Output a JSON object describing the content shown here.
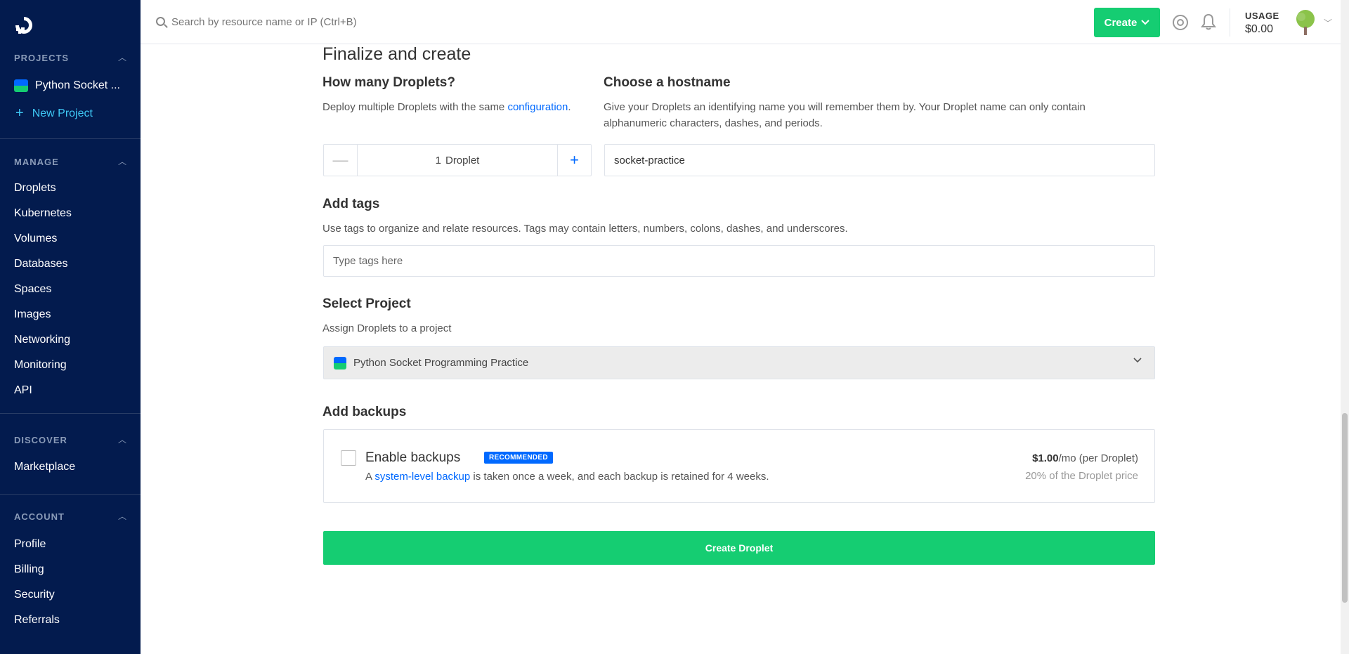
{
  "sidebar": {
    "projects_heading": "PROJECTS",
    "project_name": "Python Socket ...",
    "new_project": "New Project",
    "manage_heading": "MANAGE",
    "manage_items": [
      "Droplets",
      "Kubernetes",
      "Volumes",
      "Databases",
      "Spaces",
      "Images",
      "Networking",
      "Monitoring",
      "API"
    ],
    "discover_heading": "DISCOVER",
    "discover_items": [
      "Marketplace"
    ],
    "account_heading": "ACCOUNT",
    "account_items": [
      "Profile",
      "Billing",
      "Security",
      "Referrals"
    ]
  },
  "topbar": {
    "search_placeholder": "Search by resource name or IP (Ctrl+B)",
    "create_label": "Create",
    "usage_label": "USAGE",
    "usage_value": "$0.00"
  },
  "main": {
    "section_title": "Finalize and create",
    "droplets": {
      "heading": "How many Droplets?",
      "desc_prefix": "Deploy multiple Droplets with the same ",
      "desc_link": "configuration",
      "desc_suffix": ".",
      "count": "1",
      "unit": "Droplet"
    },
    "hostname": {
      "heading": "Choose a hostname",
      "desc": "Give your Droplets an identifying name you will remember them by. Your Droplet name can only contain alphanumeric characters, dashes, and periods.",
      "value": "socket-practice"
    },
    "tags": {
      "heading": "Add tags",
      "desc": "Use tags to organize and relate resources. Tags may contain letters, numbers, colons, dashes, and underscores.",
      "placeholder": "Type tags here"
    },
    "project": {
      "heading": "Select Project",
      "desc": "Assign Droplets to a project",
      "selected": "Python Socket Programming Practice"
    },
    "backups": {
      "heading": "Add backups",
      "title": "Enable backups",
      "badge": "RECOMMENDED",
      "desc_prefix": "A ",
      "desc_link": "system-level backup",
      "desc_suffix": " is taken once a week, and each backup is retained for 4 weeks.",
      "price": "$1.00",
      "price_suffix": "/mo (per Droplet)",
      "price_sub": "20% of the Droplet price"
    },
    "create_button": "Create Droplet"
  },
  "colors": {
    "sidebar_bg": "#031b4e",
    "accent_green": "#15cd72",
    "link_blue": "#0069ff"
  }
}
